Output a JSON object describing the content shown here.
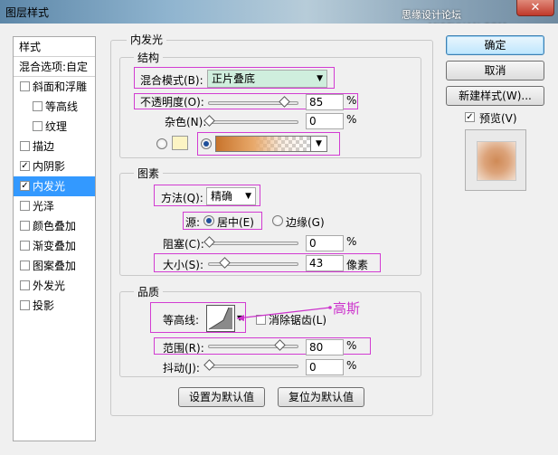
{
  "window": {
    "title": "图层样式",
    "watermark": "思缘设计论坛 www.MISSYUAN.COM",
    "close_glyph": "✕"
  },
  "left_panel": {
    "header": "样式",
    "blend_options": "混合选项:自定",
    "items": [
      {
        "label": "斜面和浮雕",
        "checked": false,
        "indent": false
      },
      {
        "label": "等高线",
        "checked": false,
        "indent": true
      },
      {
        "label": "纹理",
        "checked": false,
        "indent": true
      },
      {
        "label": "描边",
        "checked": false,
        "indent": false
      },
      {
        "label": "内阴影",
        "checked": true,
        "indent": false
      },
      {
        "label": "内发光",
        "checked": true,
        "indent": false,
        "selected": true
      },
      {
        "label": "光泽",
        "checked": false,
        "indent": false
      },
      {
        "label": "颜色叠加",
        "checked": false,
        "indent": false
      },
      {
        "label": "渐变叠加",
        "checked": false,
        "indent": false
      },
      {
        "label": "图案叠加",
        "checked": false,
        "indent": false
      },
      {
        "label": "外发光",
        "checked": false,
        "indent": false
      },
      {
        "label": "投影",
        "checked": false,
        "indent": false
      }
    ]
  },
  "panel": {
    "title": "内发光",
    "structure": {
      "title": "结构",
      "blend_mode_label": "混合模式(B):",
      "blend_mode_value": "正片叠底",
      "opacity_label": "不透明度(O):",
      "opacity_value": "85",
      "opacity_fraction": 0.85,
      "noise_label": "杂色(N):",
      "noise_value": "0",
      "noise_fraction": 0,
      "percent": "%"
    },
    "elements": {
      "title": "图素",
      "method_label": "方法(Q):",
      "method_value": "精确",
      "source_label": "源:",
      "source_center": "居中(E)",
      "source_edge": "边缘(G)",
      "choke_label": "阻塞(C):",
      "choke_value": "0",
      "choke_fraction": 0,
      "size_label": "大小(S):",
      "size_value": "43",
      "size_fraction": 0.172,
      "size_unit": "像素",
      "percent": "%"
    },
    "quality": {
      "title": "品质",
      "contour_label": "等高线:",
      "antialias_label": "消除锯齿(L)",
      "range_label": "范围(R):",
      "range_value": "80",
      "range_fraction": 0.8,
      "jitter_label": "抖动(J):",
      "jitter_value": "0",
      "jitter_fraction": 0,
      "percent": "%"
    },
    "make_default": "设置为默认值",
    "reset_default": "复位为默认值"
  },
  "buttons": {
    "ok": "确定",
    "cancel": "取消",
    "new_style": "新建样式(W)...",
    "preview_label": "预览(V)",
    "preview_checked": true
  },
  "annotation": {
    "text": "高斯"
  },
  "colors": {
    "highlight": "#d23cd2",
    "selection": "#3399ff",
    "combo_bg": "#cfeedd",
    "glow_color": "#fcf4c4"
  }
}
